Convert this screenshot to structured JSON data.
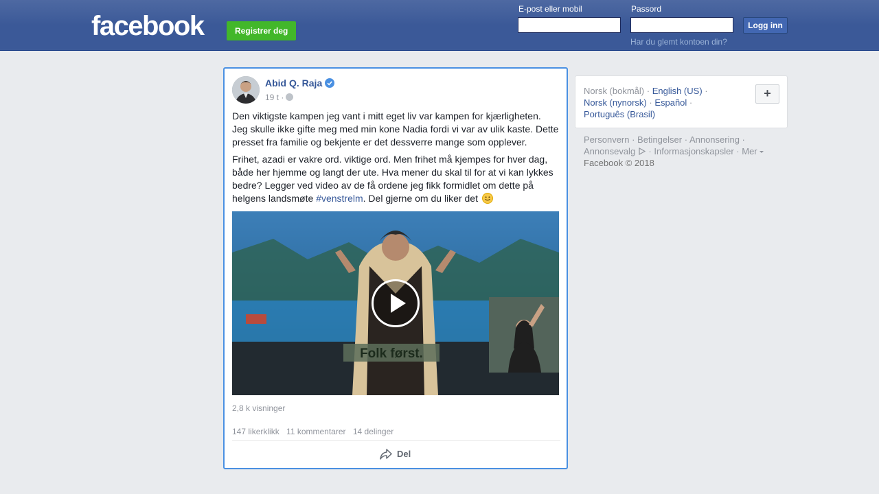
{
  "header": {
    "logo": "facebook",
    "register_label": "Registrer deg",
    "email_label": "E-post eller mobil",
    "email_value": "",
    "password_label": "Passord",
    "password_value": "",
    "login_label": "Logg inn",
    "forgot_label": "Har du glemt kontoen din?"
  },
  "post": {
    "author": "Abid Q. Raja",
    "time": "19 t ·",
    "paragraph1_line1": "Den viktigste kampen jeg vant i mitt eget liv var kampen for kjærligheten.",
    "paragraph1_line2": "Jeg skulle ikke gifte meg med min kone Nadia fordi vi var av ulik kaste. Dette presset fra familie og bekjente er det dessverre mange som opplever.",
    "paragraph2_start": "Frihet, azadi er vakre ord. viktige ord. Men frihet må kjempes for hver dag, både her hjemme og langt der ute. Hva mener du skal til for at vi kan lykkes bedre? Legger ved video av de få ordene jeg fikk formidlet om dette på helgens landsmøte ",
    "hashtag": "#venstrelm",
    "paragraph2_end": ". Del gjerne om du liker det",
    "video_caption": "Folk først.",
    "views": "2,8 k visninger",
    "likes": "147 likerklikk",
    "comments": "11 kommentarer",
    "shares": "14 delinger",
    "share_label": "Del"
  },
  "sidebar": {
    "lang_current": "Norsk (bokmål)",
    "lang_options": [
      "English (US)",
      "Norsk (nynorsk)",
      "Español",
      "Português (Brasil)"
    ],
    "add_label": "+",
    "footer": {
      "privacy": "Personvern",
      "terms": "Betingelser",
      "ads": "Annonsering",
      "ad_choices": "Annonsevalg",
      "cookies": "Informasjonskapsler",
      "more": "Mer",
      "copyright": "Facebook © 2018"
    }
  },
  "colors": {
    "brand_blue": "#3b5998",
    "green": "#42b72a",
    "link": "#365899",
    "focus_border": "#4a90e2"
  }
}
